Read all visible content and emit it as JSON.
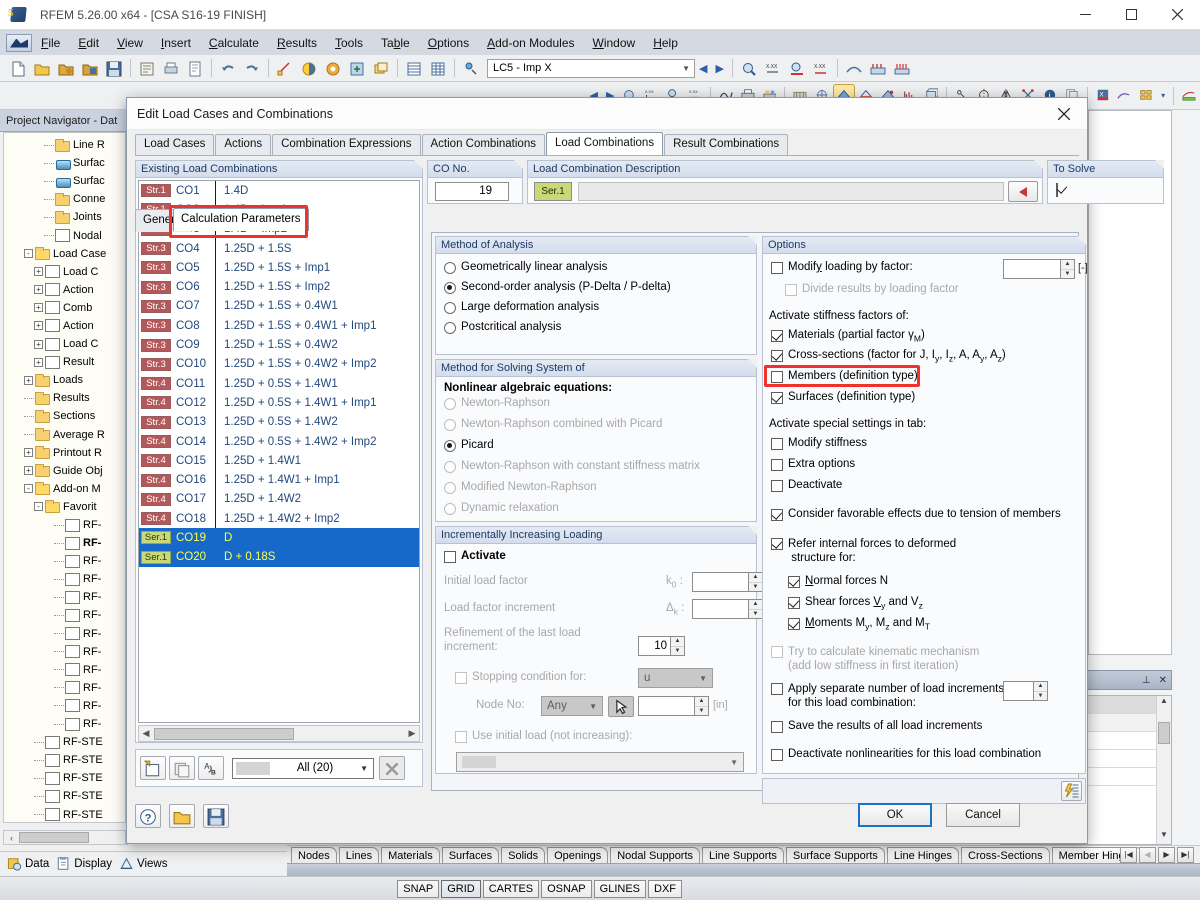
{
  "app": {
    "title": "RFEM 5.26.00 x64 - [CSA S16-19 FINISH]",
    "window_buttons": {
      "minimize": "minimize-button",
      "maximize": "maximize-button",
      "close": "close-button"
    },
    "menu": [
      "File",
      "Edit",
      "View",
      "Insert",
      "Calculate",
      "Results",
      "Tools",
      "Table",
      "Options",
      "Add-on Modules",
      "Window",
      "Help"
    ],
    "toolbar_combo_value": "LC5 - Imp X"
  },
  "navigator": {
    "header": "Project Navigator - Dat",
    "items": [
      {
        "label": "Line R",
        "indent": 4,
        "icon": "folder-icon",
        "expander": ""
      },
      {
        "label": "Surfac",
        "indent": 4,
        "icon": "surface-icon",
        "expander": ""
      },
      {
        "label": "Surfac",
        "indent": 4,
        "icon": "surface-icon",
        "expander": ""
      },
      {
        "label": "Conne",
        "indent": 4,
        "icon": "folder-icon",
        "expander": ""
      },
      {
        "label": "Joints",
        "indent": 4,
        "icon": "folder-icon",
        "expander": ""
      },
      {
        "label": "Nodal",
        "indent": 4,
        "icon": "nodal-release-icon",
        "expander": ""
      },
      {
        "label": "Load Case",
        "indent": 2,
        "icon": "folder-open-icon",
        "expander": "-"
      },
      {
        "label": "Load C",
        "indent": 3,
        "icon": "load-case-icon",
        "expander": "+"
      },
      {
        "label": "Action",
        "indent": 3,
        "icon": "action-icon",
        "expander": "+"
      },
      {
        "label": "Comb",
        "indent": 3,
        "icon": "combination-icon",
        "expander": "+"
      },
      {
        "label": "Action",
        "indent": 3,
        "icon": "action-combination-icon",
        "expander": "+"
      },
      {
        "label": "Load C",
        "indent": 3,
        "icon": "load-combination-icon",
        "expander": "+"
      },
      {
        "label": "Result",
        "indent": 3,
        "icon": "result-combination-icon",
        "expander": "+"
      },
      {
        "label": "Loads",
        "indent": 2,
        "icon": "folder-icon",
        "expander": "+"
      },
      {
        "label": "Results",
        "indent": 2,
        "icon": "folder-icon",
        "expander": ""
      },
      {
        "label": "Sections",
        "indent": 2,
        "icon": "folder-icon",
        "expander": ""
      },
      {
        "label": "Average R",
        "indent": 2,
        "icon": "folder-icon",
        "expander": ""
      },
      {
        "label": "Printout R",
        "indent": 2,
        "icon": "folder-icon",
        "expander": "+"
      },
      {
        "label": "Guide Obj",
        "indent": 2,
        "icon": "folder-icon",
        "expander": "+"
      },
      {
        "label": "Add-on M",
        "indent": 2,
        "icon": "folder-open-icon",
        "expander": "-"
      },
      {
        "label": "Favorit",
        "indent": 3,
        "icon": "folder-open-icon",
        "expander": "-"
      },
      {
        "label": "RF-",
        "indent": 5,
        "icon": "aisc-module-icon",
        "expander": ""
      },
      {
        "label": "RF-",
        "indent": 5,
        "icon": "csa-module-icon",
        "expander": "",
        "bold": true
      },
      {
        "label": "RF-",
        "indent": 5,
        "icon": "adm-module-icon",
        "expander": ""
      },
      {
        "label": "RF-",
        "indent": 5,
        "icon": "module-icon",
        "expander": ""
      },
      {
        "label": "RF-",
        "indent": 5,
        "icon": "module-icon",
        "expander": ""
      },
      {
        "label": "RF-",
        "indent": 5,
        "icon": "awc-module-icon",
        "expander": ""
      },
      {
        "label": "RF-",
        "indent": 5,
        "icon": "module-teal-icon",
        "expander": ""
      },
      {
        "label": "RF-",
        "indent": 5,
        "icon": "module-green-icon",
        "expander": ""
      },
      {
        "label": "RF-",
        "indent": 5,
        "icon": "module-purple-icon",
        "expander": ""
      },
      {
        "label": "RF-",
        "indent": 5,
        "icon": "module-green2-icon",
        "expander": ""
      },
      {
        "label": "RF-",
        "indent": 5,
        "icon": "module-green3-icon",
        "expander": ""
      },
      {
        "label": "RF-",
        "indent": 5,
        "icon": "module-green4-icon",
        "expander": ""
      },
      {
        "label": "RF-STE",
        "indent": 3,
        "icon": "steel-module-icon",
        "expander": ""
      },
      {
        "label": "RF-STE",
        "indent": 3,
        "icon": "steel-ec-icon",
        "expander": ""
      },
      {
        "label": "RF-STE",
        "indent": 3,
        "icon": "steel-ec2-icon",
        "expander": ""
      },
      {
        "label": "RF-STE",
        "indent": 3,
        "icon": "steel-is-icon",
        "expander": ""
      },
      {
        "label": "RF-STE",
        "indent": 3,
        "icon": "steel-sia-icon",
        "expander": ""
      }
    ]
  },
  "bottom_left_bar": {
    "items": [
      "Data",
      "Display",
      "Views"
    ]
  },
  "bottom_tabs": [
    "Nodes",
    "Lines",
    "Materials",
    "Surfaces",
    "Solids",
    "Openings",
    "Nodal Supports",
    "Line Supports",
    "Surface Supports",
    "Line Hinges",
    "Cross-Sections",
    "Member Hinges"
  ],
  "status_bar": {
    "toggles": [
      "SNAP",
      "GRID",
      "CARTES",
      "OSNAP",
      "GLINES",
      "DXF"
    ],
    "active": "GRID"
  },
  "dialog": {
    "title": "Edit Load Cases and Combinations",
    "tabs": [
      "Load Cases",
      "Actions",
      "Combination Expressions",
      "Action Combinations",
      "Load Combinations",
      "Result Combinations"
    ],
    "selected_tab": "Load Combinations",
    "existing": {
      "title": "Existing Load Combinations",
      "rows": [
        {
          "badge": "Str.1",
          "type": "str",
          "no": "CO1",
          "expr": "1.4D"
        },
        {
          "badge": "Str.1",
          "type": "str",
          "no": "CO2",
          "expr": "1.4D + Imp1"
        },
        {
          "badge": "Str.1",
          "type": "str",
          "no": "CO3",
          "expr": "1.4D + Imp2"
        },
        {
          "badge": "Str.3",
          "type": "str",
          "no": "CO4",
          "expr": "1.25D + 1.5S"
        },
        {
          "badge": "Str.3",
          "type": "str",
          "no": "CO5",
          "expr": "1.25D + 1.5S + Imp1"
        },
        {
          "badge": "Str.3",
          "type": "str",
          "no": "CO6",
          "expr": "1.25D + 1.5S + Imp2"
        },
        {
          "badge": "Str.3",
          "type": "str",
          "no": "CO7",
          "expr": "1.25D + 1.5S + 0.4W1"
        },
        {
          "badge": "Str.3",
          "type": "str",
          "no": "CO8",
          "expr": "1.25D + 1.5S + 0.4W1 + Imp1"
        },
        {
          "badge": "Str.3",
          "type": "str",
          "no": "CO9",
          "expr": "1.25D + 1.5S + 0.4W2"
        },
        {
          "badge": "Str.3",
          "type": "str",
          "no": "CO10",
          "expr": "1.25D + 1.5S + 0.4W2 + Imp2"
        },
        {
          "badge": "Str.4",
          "type": "str",
          "no": "CO11",
          "expr": "1.25D + 0.5S + 1.4W1"
        },
        {
          "badge": "Str.4",
          "type": "str",
          "no": "CO12",
          "expr": "1.25D + 0.5S + 1.4W1 + Imp1"
        },
        {
          "badge": "Str.4",
          "type": "str",
          "no": "CO13",
          "expr": "1.25D + 0.5S + 1.4W2"
        },
        {
          "badge": "Str.4",
          "type": "str",
          "no": "CO14",
          "expr": "1.25D + 0.5S + 1.4W2 + Imp2"
        },
        {
          "badge": "Str.4",
          "type": "str",
          "no": "CO15",
          "expr": "1.25D + 1.4W1"
        },
        {
          "badge": "Str.4",
          "type": "str",
          "no": "CO16",
          "expr": "1.25D + 1.4W1 + Imp1"
        },
        {
          "badge": "Str.4",
          "type": "str",
          "no": "CO17",
          "expr": "1.25D + 1.4W2"
        },
        {
          "badge": "Str.4",
          "type": "str",
          "no": "CO18",
          "expr": "1.25D + 1.4W2 + Imp2"
        },
        {
          "badge": "Ser.1",
          "type": "ser",
          "no": "CO19",
          "expr": "D",
          "selected": true
        },
        {
          "badge": "Ser.1",
          "type": "ser",
          "no": "CO20",
          "expr": "D + 0.18S",
          "selected": true
        }
      ],
      "filter_value": "All (20)"
    },
    "co_no": {
      "title": "CO No.",
      "value": "19"
    },
    "description": {
      "title": "Load Combination Description",
      "badge": "Ser.1",
      "value": ""
    },
    "to_solve": {
      "title": "To Solve",
      "checked": true
    },
    "inner_tabs": {
      "general": "General",
      "calculation": "Calculation Parameters",
      "selected": "Calculation Parameters"
    },
    "method_of_analysis": {
      "title": "Method of Analysis",
      "options": [
        {
          "label": "Geometrically linear analysis",
          "selected": false
        },
        {
          "label": "Second-order analysis (P-Delta / P-delta)",
          "selected": true
        },
        {
          "label": "Large deformation analysis",
          "selected": false
        },
        {
          "label": "Postcritical analysis",
          "selected": false
        }
      ]
    },
    "solving_method": {
      "title": "Method for Solving System of",
      "subtitle": "Nonlinear algebraic equations:",
      "options": [
        {
          "label": "Newton-Raphson",
          "selected": false,
          "disabled": true
        },
        {
          "label": "Newton-Raphson combined with Picard",
          "selected": false,
          "disabled": true
        },
        {
          "label": "Picard",
          "selected": true,
          "disabled": false
        },
        {
          "label": "Newton-Raphson with constant stiffness matrix",
          "selected": false,
          "disabled": true
        },
        {
          "label": "Modified Newton-Raphson",
          "selected": false,
          "disabled": true
        },
        {
          "label": "Dynamic relaxation",
          "selected": false,
          "disabled": true
        }
      ]
    },
    "incremental": {
      "title": "Incrementally Increasing Loading",
      "activate": {
        "label": "Activate",
        "checked": false
      },
      "initial_load_factor": {
        "label": "Initial load factor",
        "symbol": "k0 :",
        "value": "",
        "unit": "[-]"
      },
      "load_factor_increment": {
        "label": "Load factor increment",
        "symbol": "Δk :",
        "value": "",
        "unit": "[-]"
      },
      "refinement": {
        "label": "Refinement of the last load increment:",
        "value": "10"
      },
      "stopping_condition": {
        "label": "Stopping condition for:",
        "checked": false,
        "value": "u"
      },
      "node_no": {
        "label": "Node No:",
        "value": "Any",
        "field": "",
        "unit": "[in]"
      },
      "use_initial_load": {
        "label": "Use initial load (not increasing):",
        "checked": false,
        "value": ""
      }
    },
    "options": {
      "title": "Options",
      "modify_loading": {
        "label": "Modify loading by factor:",
        "checked": false,
        "value": "",
        "unit": "[-]"
      },
      "divide_results": {
        "label": "Divide results by loading factor",
        "checked": false,
        "disabled": true
      },
      "stiffness_header": "Activate stiffness factors of:",
      "stiffness_items": [
        {
          "label": "Materials (partial factor γM)",
          "checked": true
        },
        {
          "label": "Cross-sections (factor for J, Iy, Iz, A, Ay, Az)",
          "checked": true
        },
        {
          "label": "Members (definition type)",
          "checked": false,
          "highlighted": true
        },
        {
          "label": "Surfaces (definition type)",
          "checked": true
        }
      ],
      "special_header": "Activate special settings in tab:",
      "special_items": [
        {
          "label": "Modify stiffness",
          "checked": false
        },
        {
          "label": "Extra options",
          "checked": false
        },
        {
          "label": "Deactivate",
          "checked": false
        }
      ],
      "favorable_effects": {
        "label": "Consider favorable effects due to tension of members",
        "checked": true
      },
      "refer_internal": {
        "label": "Refer internal forces to deformed structure for:",
        "checked": true
      },
      "refer_sub": [
        {
          "label": "Normal forces N",
          "checked": true
        },
        {
          "label": "Shear forces Vy and Vz",
          "checked": true
        },
        {
          "label": "Moments My, Mz and MT",
          "checked": true
        }
      ],
      "kinematic": {
        "label": "Try to calculate kinematic mechanism (add low stiffness in first iteration)",
        "checked": false,
        "disabled": true
      },
      "apply_separate": {
        "label": "Apply separate number of load increments for this load combination:",
        "checked": false,
        "value": ""
      },
      "save_results": {
        "label": "Save the results of all load increments",
        "checked": false
      },
      "deactivate_nonlin": {
        "label": "Deactivate nonlinearities for this load combination",
        "checked": false
      }
    },
    "footer": {
      "ok": "OK",
      "cancel": "Cancel"
    }
  },
  "colors": {
    "highlight_red": "#f1322c",
    "selection_blue": "#1669c9",
    "selection_text": "#ffff4a",
    "strength_badge": "#b3595b",
    "service_badge": "#c9d977",
    "group_title": "#1b3a66"
  }
}
